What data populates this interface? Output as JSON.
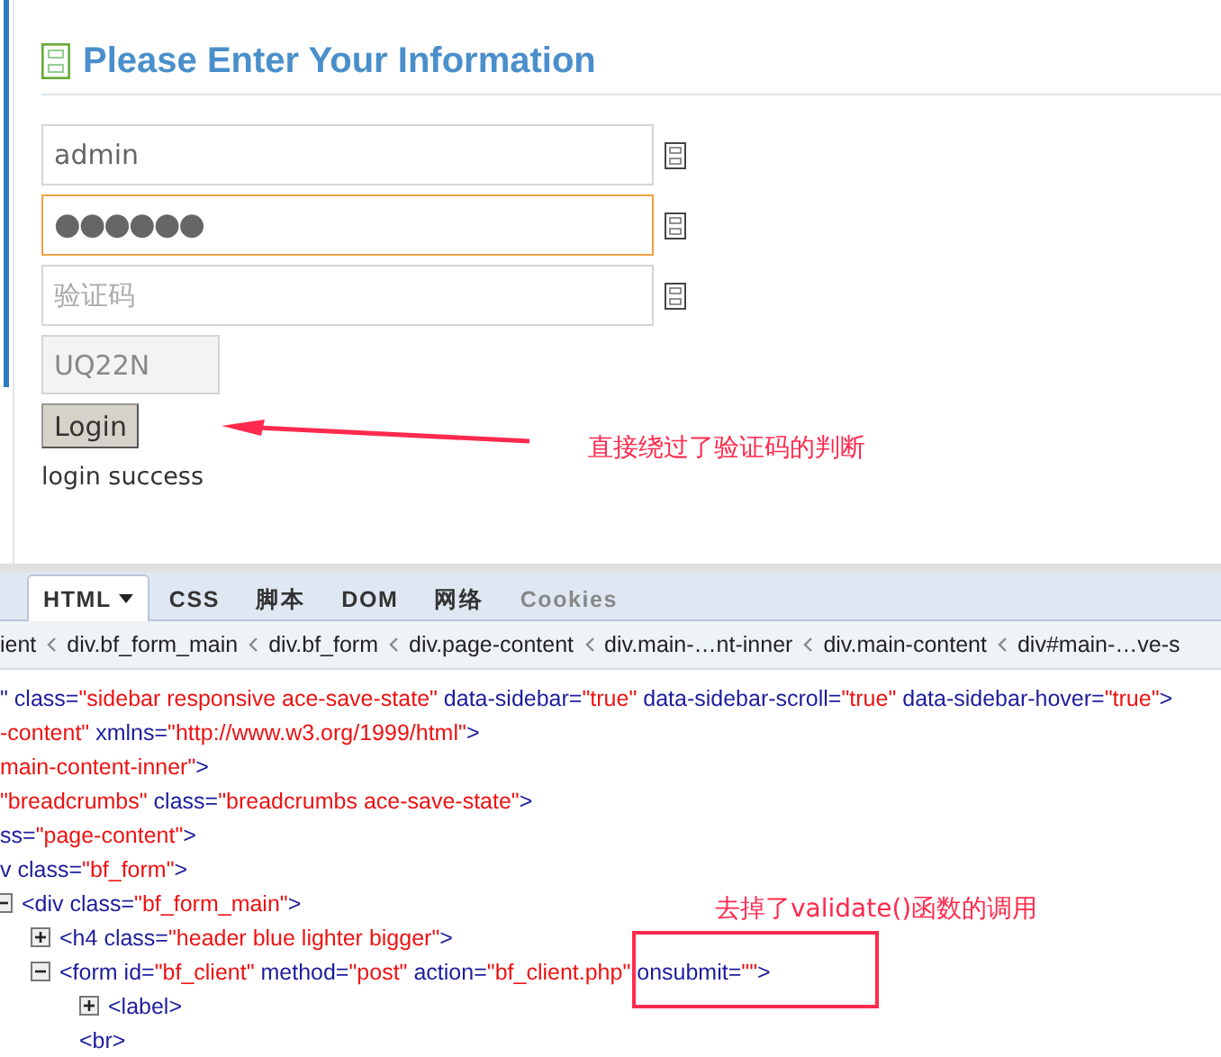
{
  "form": {
    "heading": "Please Enter Your Information",
    "fields": [
      {
        "kind": "text",
        "value": "admin",
        "focused": false
      },
      {
        "kind": "password",
        "value": "●●●●●●",
        "focused": true
      },
      {
        "kind": "text",
        "placeholder": "验证码",
        "focused": false
      }
    ],
    "captcha": "UQ22N",
    "login_button": "Login",
    "message": "login success"
  },
  "annotations": [
    {
      "kind": "arrow",
      "text": "直接绕过了验证码的判断"
    },
    {
      "kind": "box",
      "text": "去掉了validate()函数的调用"
    }
  ],
  "devtools": {
    "tabs": [
      {
        "label": "HTML",
        "selected": true,
        "disabled": false,
        "dropdown": true
      },
      {
        "label": "CSS",
        "selected": false,
        "disabled": false,
        "dropdown": false
      },
      {
        "label": "脚本",
        "selected": false,
        "disabled": false,
        "dropdown": false
      },
      {
        "label": "DOM",
        "selected": false,
        "disabled": false,
        "dropdown": false
      },
      {
        "label": "网络",
        "selected": false,
        "disabled": false,
        "dropdown": false
      },
      {
        "label": "Cookies",
        "selected": false,
        "disabled": true,
        "dropdown": false
      }
    ],
    "breadcrumbs": [
      "ient",
      "div.bf_form_main",
      "div.bf_form",
      "div.page-content",
      "div.main-…nt-inner",
      "div.main-content",
      "div#main-…ve-s"
    ],
    "code_lines": [
      {
        "tokens": [
          {
            "kind": "tag",
            "text": "\""
          },
          {
            "kind": "attr",
            "text": " class="
          },
          {
            "kind": "value",
            "text": "\"sidebar responsive ace-save-state\""
          },
          {
            "kind": "attr",
            "text": " data-sidebar="
          },
          {
            "kind": "value",
            "text": "\"true\""
          },
          {
            "kind": "attr",
            "text": " data-sidebar-scroll="
          },
          {
            "kind": "value",
            "text": "\"true\""
          },
          {
            "kind": "attr",
            "text": " data-sidebar-hover="
          },
          {
            "kind": "value",
            "text": "\"true\""
          },
          {
            "kind": "tag",
            "text": ">"
          }
        ]
      },
      {
        "tokens": [
          {
            "kind": "value",
            "text": "-content\""
          },
          {
            "kind": "attr",
            "text": " xmlns="
          },
          {
            "kind": "value",
            "text": "\"http://www.w3.org/1999/html\""
          },
          {
            "kind": "tag",
            "text": ">"
          }
        ]
      },
      {
        "tokens": [
          {
            "kind": "value",
            "text": "main-content-inner\""
          },
          {
            "kind": "tag",
            "text": ">"
          }
        ]
      },
      {
        "tokens": [
          {
            "kind": "value",
            "text": "\"breadcrumbs\""
          },
          {
            "kind": "attr",
            "text": " class="
          },
          {
            "kind": "value",
            "text": "\"breadcrumbs ace-save-state\""
          },
          {
            "kind": "tag",
            "text": ">"
          }
        ]
      },
      {
        "tokens": [
          {
            "kind": "attr",
            "text": "ss="
          },
          {
            "kind": "value",
            "text": "\"page-content\""
          },
          {
            "kind": "tag",
            "text": ">"
          }
        ]
      },
      {
        "tokens": [
          {
            "kind": "tag",
            "text": "v"
          },
          {
            "kind": "attr",
            "text": " class="
          },
          {
            "kind": "value",
            "text": "\"bf_form\""
          },
          {
            "kind": "tag",
            "text": ">"
          }
        ]
      },
      {
        "expanded": true,
        "tokens": [
          {
            "kind": "tag",
            "text": "<div"
          },
          {
            "kind": "attr",
            "text": " class="
          },
          {
            "kind": "value",
            "text": "\"bf_form_main\""
          },
          {
            "kind": "tag",
            "text": ">"
          }
        ],
        "children": [
          {
            "expanded": false,
            "tokens": [
              {
                "kind": "tag",
                "text": "<h4"
              },
              {
                "kind": "attr",
                "text": " class="
              },
              {
                "kind": "value",
                "text": "\"header blue lighter bigger\""
              },
              {
                "kind": "tag",
                "text": ">"
              }
            ]
          },
          {
            "expanded": true,
            "tokens": [
              {
                "kind": "tag",
                "text": "<form"
              },
              {
                "kind": "attr",
                "text": " id="
              },
              {
                "kind": "value",
                "text": "\"bf_client\""
              },
              {
                "kind": "attr",
                "text": " method="
              },
              {
                "kind": "value",
                "text": "\"post\""
              },
              {
                "kind": "attr",
                "text": " action="
              },
              {
                "kind": "value",
                "text": "\"bf_client.php\""
              },
              {
                "kind": "attr",
                "text": " onsubmit="
              },
              {
                "kind": "value",
                "text": "\"\""
              },
              {
                "kind": "tag",
                "text": ">"
              }
            ],
            "children": [
              {
                "expanded": false,
                "tokens": [
                  {
                    "kind": "tag",
                    "text": "<label>"
                  }
                ]
              },
              {
                "tokens": [
                  {
                    "kind": "tag",
                    "text": "<br>"
                  }
                ]
              }
            ]
          }
        ]
      }
    ]
  }
}
